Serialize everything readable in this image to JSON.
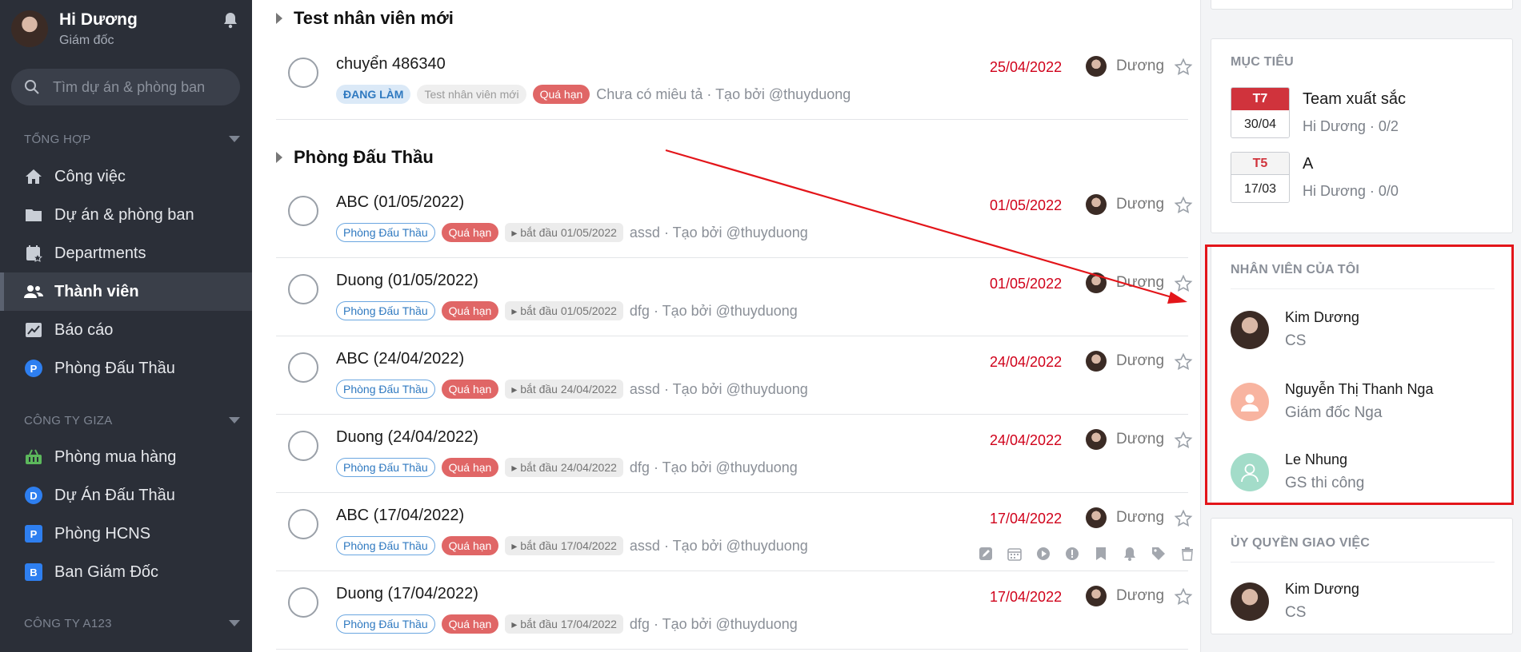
{
  "sidebar": {
    "user_name": "Hi Dương",
    "user_role": "Giám đốc",
    "search_placeholder": "Tìm dự án & phòng ban",
    "sections": [
      {
        "title": "TỔNG HỢP"
      },
      {
        "title": "CÔNG TY GIZA"
      },
      {
        "title": "CÔNG TY A123"
      }
    ],
    "items": [
      {
        "label": "Công việc",
        "icon": "home-icon"
      },
      {
        "label": "Dự án & phòng ban",
        "icon": "folder-icon"
      },
      {
        "label": "Departments",
        "icon": "calendar-star-icon"
      },
      {
        "label": "Thành viên",
        "icon": "users-icon"
      },
      {
        "label": "Báo cáo",
        "icon": "chart-icon"
      },
      {
        "label": "Phòng Đấu Thầu",
        "badge": "P"
      },
      {
        "label": "Phòng mua hàng",
        "icon": "basket-icon"
      },
      {
        "label": "Dự Án Đấu Thầu",
        "badge": "D"
      },
      {
        "label": "Phòng HCNS",
        "badge": "P"
      },
      {
        "label": "Ban Giám Đốc",
        "badge": "B"
      }
    ],
    "accent_color": "#2e7ff0"
  },
  "main": {
    "groups": [
      {
        "title": "Test nhân viên mới"
      },
      {
        "title": "Phòng Đấu Thầu"
      }
    ],
    "tasks": [
      {
        "title": "chuyển 486340",
        "status": "ĐANG LÀM",
        "label": "Test nhân viên mới",
        "overdue": "Quá hạn",
        "desc": "Chưa có miêu tả · Tạo bởi @thuyduong",
        "date": "25/04/2022",
        "assignee": "Dương"
      },
      {
        "title": "ABC (01/05/2022)",
        "project": "Phòng Đấu Thầu",
        "overdue": "Quá hạn",
        "start": "bắt đầu 01/05/2022",
        "desc": "assd · Tạo bởi @thuyduong",
        "date": "01/05/2022",
        "assignee": "Dương"
      },
      {
        "title": "Duong (01/05/2022)",
        "project": "Phòng Đấu Thầu",
        "overdue": "Quá hạn",
        "start": "bắt đầu 01/05/2022",
        "desc": "dfg · Tạo bởi @thuyduong",
        "date": "01/05/2022",
        "assignee": "Dương"
      },
      {
        "title": "ABC (24/04/2022)",
        "project": "Phòng Đấu Thầu",
        "overdue": "Quá hạn",
        "start": "bắt đầu 24/04/2022",
        "desc": "assd · Tạo bởi @thuyduong",
        "date": "24/04/2022",
        "assignee": "Dương"
      },
      {
        "title": "Duong (24/04/2022)",
        "project": "Phòng Đấu Thầu",
        "overdue": "Quá hạn",
        "start": "bắt đầu 24/04/2022",
        "desc": "dfg · Tạo bởi @thuyduong",
        "date": "24/04/2022",
        "assignee": "Dương"
      },
      {
        "title": "ABC (17/04/2022)",
        "project": "Phòng Đấu Thầu",
        "overdue": "Quá hạn",
        "start": "bắt đầu 17/04/2022",
        "desc": "assd · Tạo bởi @thuyduong",
        "date": "17/04/2022",
        "assignee": "Dương"
      },
      {
        "title": "Duong (17/04/2022)",
        "project": "Phòng Đấu Thầu",
        "overdue": "Quá hạn",
        "start": "bắt đầu 17/04/2022",
        "desc": "dfg · Tạo bởi @thuyduong",
        "date": "17/04/2022",
        "assignee": "Dương"
      }
    ],
    "overdue_color": "#d0021b",
    "task_action_icons": [
      "edit-icon",
      "calendar-icon",
      "play-icon",
      "alert-icon",
      "bookmark-icon",
      "bell-icon",
      "tag-icon",
      "trash-icon"
    ]
  },
  "right": {
    "goals_title": "MỤC TIÊU",
    "goals": [
      {
        "weekday": "T7",
        "date": "30/04",
        "name": "Team xuất sắc",
        "owner": "Hi Dương  ·  0/2"
      },
      {
        "weekday": "T5",
        "date": "17/03",
        "name": "A",
        "owner": "Hi Dương  ·  0/0"
      }
    ],
    "staff_title": "NHÂN VIÊN CỦA TÔI",
    "staff": [
      {
        "name": "Kim Dương",
        "role": "CS"
      },
      {
        "name": "Nguyễn Thị Thanh Nga",
        "role": "Giám đốc Nga"
      },
      {
        "name": "Le Nhung",
        "role": "GS thi công"
      }
    ],
    "delegate_title": "ỦY QUYỀN GIAO VIỆC",
    "delegates": [
      {
        "name": "Kim Dương",
        "role": "CS"
      }
    ],
    "annotation_color": "#e3151a"
  }
}
